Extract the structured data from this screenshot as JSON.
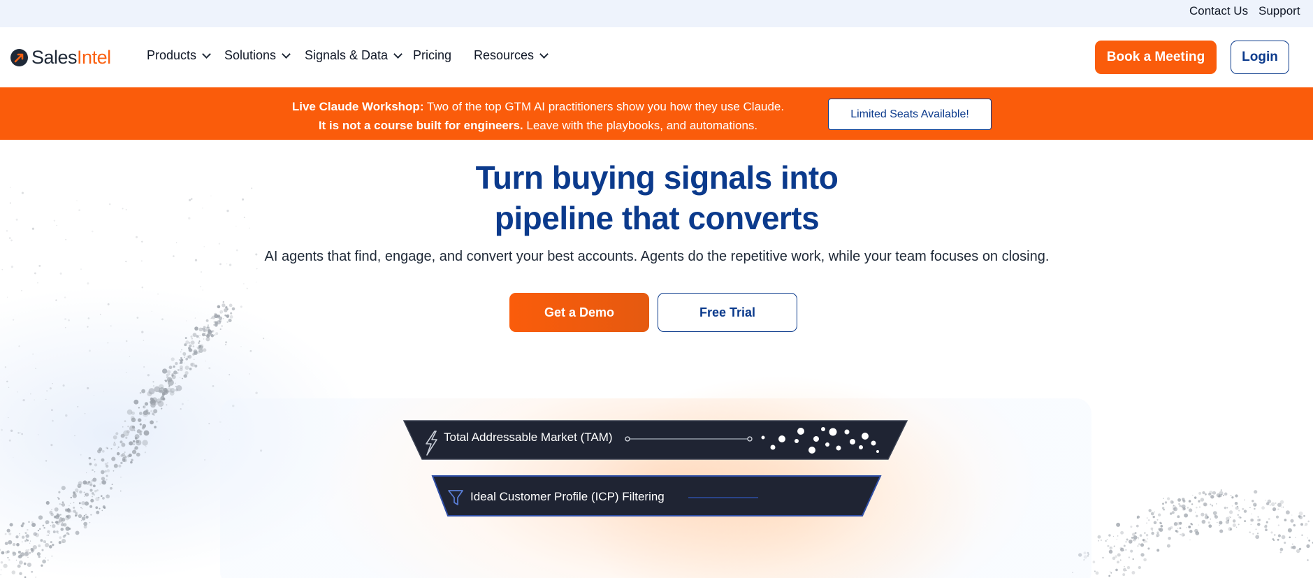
{
  "utility_bar": {
    "contact_us": "Contact Us",
    "support": "Support"
  },
  "logo": {
    "part1": "Sales",
    "part2": "Intel"
  },
  "nav": {
    "products": "Products",
    "solutions": "Solutions",
    "signals_data": "Signals & Data",
    "pricing": "Pricing",
    "resources": "Resources"
  },
  "cta": {
    "book_meeting": "Book a Meeting",
    "login": "Login"
  },
  "promo": {
    "bold1": "Live Claude Workshop:",
    "text1": " Two of the top GTM AI practitioners show you how they use Claude.",
    "bold2": "It is not a course built for engineers.",
    "text2": " Leave with the playbooks, and automations.",
    "button": "Limited Seats Available!"
  },
  "hero": {
    "headline_line1": "Turn buying signals into",
    "headline_line2": "pipeline that converts",
    "subhead": "AI agents that find, engage, and convert your best accounts. Agents do the repetitive work, while your team focuses on closing.",
    "demo_button": "Get a Demo",
    "trial_button": "Free Trial"
  },
  "funnel": {
    "steps": [
      {
        "label": "Total Addressable Market (TAM)",
        "icon": "lightning-icon"
      },
      {
        "label": "Ideal Customer Profile (ICP) Filtering",
        "icon": "funnel-icon"
      }
    ]
  },
  "colors": {
    "brand_orange": "#fa5c0b",
    "brand_blue": "#0b3a8c",
    "funnel_dark": "#1f2433"
  }
}
